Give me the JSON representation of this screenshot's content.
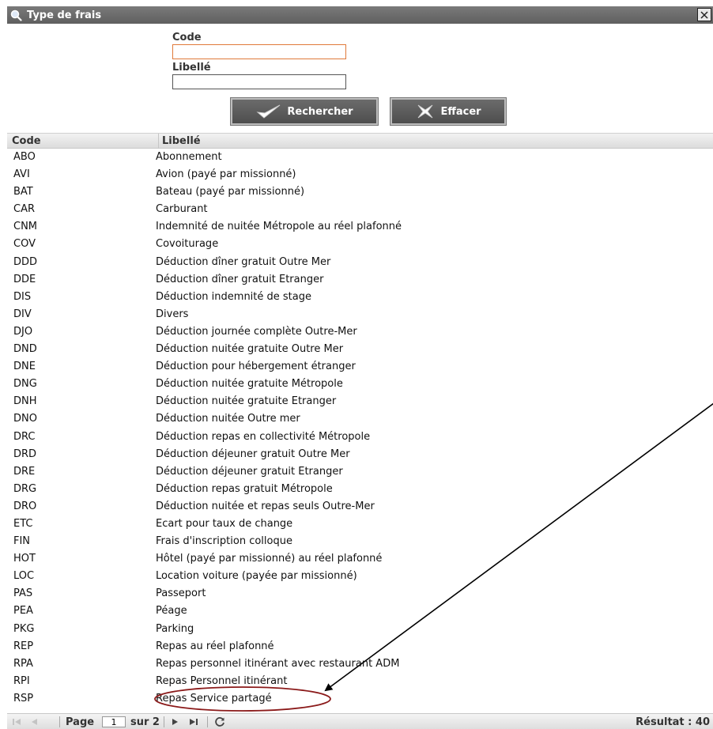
{
  "window": {
    "title": "Type de frais",
    "close_label": "✕"
  },
  "search": {
    "code_label": "Code",
    "code_value": "",
    "libelle_label": "Libellé",
    "libelle_value": "",
    "search_button": "Rechercher",
    "clear_button": "Effacer"
  },
  "grid": {
    "columns": [
      "Code",
      "Libellé"
    ],
    "rows": [
      {
        "code": "ABO",
        "label": "Abonnement"
      },
      {
        "code": "AVI",
        "label": "Avion (payé par missionné)"
      },
      {
        "code": "BAT",
        "label": "Bateau (payé par missionné)"
      },
      {
        "code": "CAR",
        "label": "Carburant"
      },
      {
        "code": "CNM",
        "label": "Indemnité de nuitée Métropole au réel plafonné"
      },
      {
        "code": "COV",
        "label": "Covoiturage"
      },
      {
        "code": "DDD",
        "label": "Déduction dîner gratuit Outre Mer"
      },
      {
        "code": "DDE",
        "label": "Déduction dîner gratuit Etranger"
      },
      {
        "code": "DIS",
        "label": "Déduction indemnité de stage"
      },
      {
        "code": "DIV",
        "label": "Divers"
      },
      {
        "code": "DJO",
        "label": "Déduction journée complète Outre-Mer"
      },
      {
        "code": "DND",
        "label": "Déduction nuitée gratuite Outre Mer"
      },
      {
        "code": "DNE",
        "label": "Déduction pour hébergement étranger"
      },
      {
        "code": "DNG",
        "label": "Déduction nuitée gratuite Métropole"
      },
      {
        "code": "DNH",
        "label": "Déduction nuitée gratuite Etranger"
      },
      {
        "code": "DNO",
        "label": "Déduction nuitée Outre mer"
      },
      {
        "code": "DRC",
        "label": "Déduction repas en collectivité Métropole"
      },
      {
        "code": "DRD",
        "label": "Déduction déjeuner gratuit Outre Mer"
      },
      {
        "code": "DRE",
        "label": "Déduction déjeuner gratuit Etranger"
      },
      {
        "code": "DRG",
        "label": "Déduction repas gratuit Métropole"
      },
      {
        "code": "DRO",
        "label": "Déduction nuitée et repas seuls Outre-Mer"
      },
      {
        "code": "ETC",
        "label": "Ecart pour taux de change"
      },
      {
        "code": "FIN",
        "label": "Frais d'inscription colloque"
      },
      {
        "code": "HOT",
        "label": "Hôtel (payé par missionné) au réel plafonné"
      },
      {
        "code": "LOC",
        "label": "Location voiture (payée par missionné)"
      },
      {
        "code": "PAS",
        "label": "Passeport"
      },
      {
        "code": "PEA",
        "label": "Péage"
      },
      {
        "code": "PKG",
        "label": "Parking"
      },
      {
        "code": "REP",
        "label": "Repas au réel plafonné"
      },
      {
        "code": "RPA",
        "label": "Repas personnel itinérant avec restaurant ADM"
      },
      {
        "code": "RPI",
        "label": "Repas Personnel itinérant"
      },
      {
        "code": "RSP",
        "label": "Repas Service partagé"
      }
    ]
  },
  "pager": {
    "page_label": "Page",
    "page_value": "1",
    "of_label": "sur 2",
    "result_label": "Résultat : 40"
  },
  "annotation": {
    "highlight_row": "RSP",
    "ellipse_color": "#8b1a1a",
    "arrow_color": "#000000"
  }
}
